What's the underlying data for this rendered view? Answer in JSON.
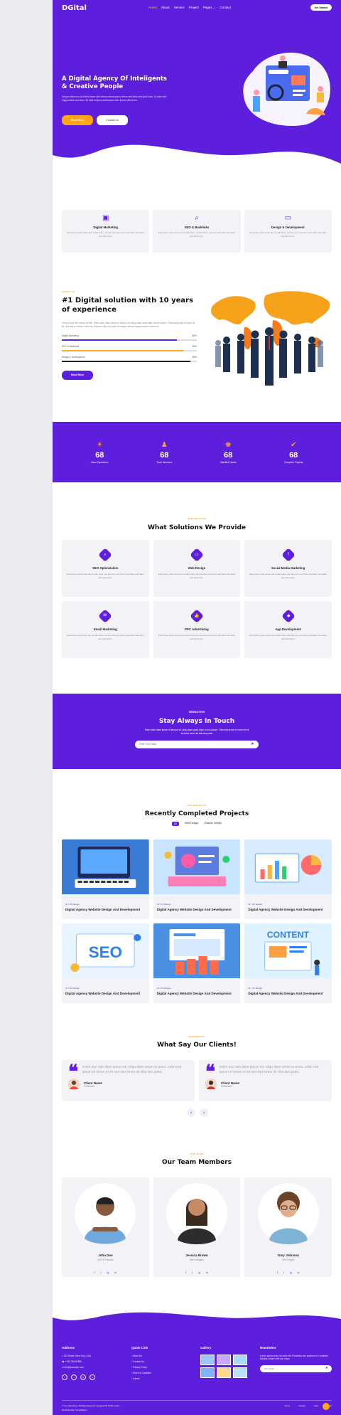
{
  "nav": {
    "logo": "DGital",
    "links": [
      "Home",
      "About",
      "Service",
      "Project",
      "Pages",
      "Contact"
    ],
    "pages_caret": "⌄",
    "cta": "Get Started"
  },
  "hero": {
    "title": "A Digital Agency Of Inteligents & Creative People",
    "desc": "Tempor rebum no at dolore lorem clita rebum rebum ipsum rebum stet dolor sed justo kasd. Ut dolor sed magna dolor sea diam. Sit diam sit justo amet ipsum vero ipsum clita lorem",
    "btn_primary": "Read More",
    "btn_secondary": "Contact Us"
  },
  "features": [
    {
      "icon": "▣",
      "title": "Digital Marketing",
      "desc": "Erat ipsum justo amet duo et elitr dolor, est duo duo eos lorem sed diam stet diam sed stet lorem."
    },
    {
      "icon": "⌕",
      "title": "SEO & Backlinks",
      "desc": "Erat ipsum justo amet duo et elitr dolor, est duo duo eos lorem sed diam stet diam sed stet lorem."
    },
    {
      "icon": "▭",
      "title": "Design & Development",
      "desc": "Erat ipsum justo amet duo et elitr dolor, est duo duo eos lorem sed diam stet diam sed stet lorem."
    }
  ],
  "about": {
    "tag": "ABOUT US",
    "title": "#1 Digital solution with 10 years of experience",
    "desc": "Tempor erat elitr rebum at clita. Diam dolor diam ipsum et tempor sit. Aliqu diam amet diam et eos labore. Clita erat ipsum et lorem et sit, sed stet no labore lorem sit. Sanctus clita duo justo et tempor eirmod magna dolore erat amet",
    "skills": [
      {
        "name": "Digital Marketing",
        "pct": "85%",
        "value": 0.85
      },
      {
        "name": "SEO & Backlinks",
        "pct": "90%",
        "value": 0.9
      },
      {
        "name": "Design & Development",
        "pct": "95%",
        "value": 0.95
      }
    ],
    "btn": "Read More"
  },
  "stats": [
    {
      "icon": "☀",
      "num": "68",
      "label": "Years Experience"
    },
    {
      "icon": "♟",
      "num": "68",
      "label": "Team Members"
    },
    {
      "icon": "♚",
      "num": "68",
      "label": "Satisfied Clients"
    },
    {
      "icon": "✔",
      "num": "68",
      "label": "Complete Projects"
    }
  ],
  "services": {
    "tag": "OUR SERVICES",
    "title": "What Solutions We Provide",
    "items": [
      {
        "icon": "⌕",
        "title": "SEO Optimization",
        "desc": "Erat ipsum justo amet duo et elitr dolor, est duo duo eos lorem sed diam stet diam sed stet lorem."
      },
      {
        "icon": "▭",
        "title": "Web Design",
        "desc": "Erat ipsum justo amet duo et elitr dolor, est duo duo eos lorem sed diam stet diam sed stet lorem."
      },
      {
        "icon": "f",
        "title": "Social Media Marketing",
        "desc": "Erat ipsum justo amet duo et elitr dolor, est duo duo eos lorem sed diam stet diam sed stet lorem."
      },
      {
        "icon": "✉",
        "title": "Email Marketing",
        "desc": "Erat ipsum justo amet duo et elitr dolor, est duo duo eos lorem sed diam stet diam sed stet lorem."
      },
      {
        "icon": "👍",
        "title": "PPC Advertising",
        "desc": "Erat ipsum justo amet duo et elitr dolor, est duo duo eos lorem sed diam stet diam sed stet lorem."
      },
      {
        "icon": "◆",
        "title": "App Development",
        "desc": "Erat ipsum justo amet duo et elitr dolor, est duo duo eos lorem sed diam stet diam sed stet lorem."
      }
    ]
  },
  "newsletter": {
    "tag": "NEWSLETTER",
    "title": "Stay Always In Touch",
    "desc": "Diam dolor diam ipsum et tempor sit. Aliqu diam amet diam et eos labore. Clita erat ipsum et lorem et sit sed stet lorem sit clita duo justo",
    "placeholder": "Enter Your Email"
  },
  "projects": {
    "tag": "OUR PROJECTS",
    "title": "Recently Completed Projects",
    "filters": [
      "All",
      "Web Design",
      "Graphic Design"
    ],
    "items": [
      {
        "cat": "UI / UX Design",
        "title": "Digital Agency Website Design And Development"
      },
      {
        "cat": "UI / UX Design",
        "title": "Digital Agency Website Design And Development"
      },
      {
        "cat": "UI / UX Design",
        "title": "Digital Agency Website Design And Development"
      },
      {
        "cat": "UI / UX Design",
        "title": "Digital Agency Website Design And Development"
      },
      {
        "cat": "UI / UX Design",
        "title": "Digital Agency Website Design And Development"
      },
      {
        "cat": "UI / UX Design",
        "title": "Digital Agency Website Design And Development"
      }
    ],
    "img_labels": [
      "SEO",
      "CONTENT"
    ]
  },
  "testimonial": {
    "tag": "TESTIMONIAL",
    "title": "What Say Our Clients!",
    "items": [
      {
        "text": "Dolor duo stet diam ipsum sit. Aliqu diam amet no amet. Clita erat ipsum et lorem et sit sed stet lorem sit clita duo justo.",
        "name": "Client Name",
        "role": "Profession"
      },
      {
        "text": "Dolor duo stet diam ipsum sit. Aliqu diam amet no amet. Clita erat ipsum et lorem et sit sed stet lorem sit clita duo justo.",
        "name": "Client Name",
        "role": "Profession"
      }
    ],
    "prev": "‹",
    "next": "›"
  },
  "team": {
    "tag": "OUR TEAM",
    "title": "Our Team Members",
    "members": [
      {
        "name": "John Doe",
        "role": "CEO & Founder"
      },
      {
        "name": "Jessica Brown",
        "role": "Web Designer"
      },
      {
        "name": "Tony Johnson",
        "role": "SEO Expert"
      }
    ],
    "social": [
      "f",
      "t",
      "ig",
      "in"
    ]
  },
  "footer": {
    "address_h": "Address",
    "address": [
      "123 Street, New York, USA",
      "+012 345 67890",
      "info@example.com"
    ],
    "social": [
      "t",
      "f",
      "ig",
      "in"
    ],
    "quick_h": "Quick Link",
    "quick": [
      "About Us",
      "Contact Us",
      "Privacy Policy",
      "Terms & Condition",
      "Career"
    ],
    "gallery_h": "Gallery",
    "news_h": "Newsletter",
    "news_desc": "Lorem ipsum dolor sit amet elit. Phasellus nec pretium mi. Curabitur facilisis ornare velit non vulpu",
    "news_placeholder": "Your Email",
    "copyright": "© Your Site Name, All Right Reserved. Designed By HTML Codex",
    "distributed": "Distributed By ThemeWagon",
    "bottom_links": [
      "Home",
      "Cookies",
      "Help",
      "FQAs"
    ],
    "top_btn": "↑"
  },
  "colors": {
    "primary": "#5d1fdc",
    "accent": "#ffa51a"
  }
}
